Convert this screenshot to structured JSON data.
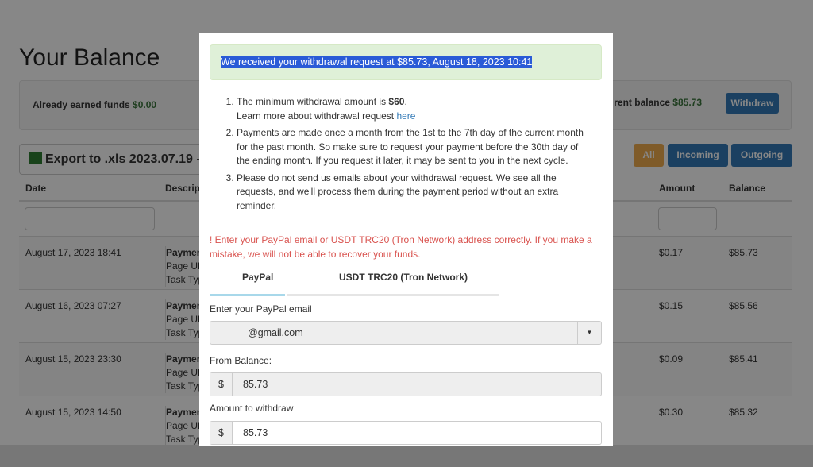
{
  "page": {
    "title": "Your Balance",
    "earned_label": "Already earned funds",
    "earned_value": "$0.00",
    "current_label": "rent balance",
    "current_value": "$85.73",
    "withdraw": "Withdraw",
    "export": "Export to .xls 2023.07.19 -",
    "filters": [
      "All",
      "Incoming",
      "Outgoing"
    ],
    "columns": {
      "date": "Date",
      "description": "Descrip",
      "amount": "Amount",
      "balance": "Balance"
    },
    "rows": [
      {
        "date": "August 17, 2023 18:41",
        "d1": "Payment",
        "d2": "Page URL",
        "d3": "Task Type",
        "amount": "$0.17",
        "balance": "$85.73"
      },
      {
        "date": "August 16, 2023 07:27",
        "d1": "Payment",
        "d2": "Page URL",
        "d3": "Task Type",
        "amount": "$0.15",
        "balance": "$85.56"
      },
      {
        "date": "August 15, 2023 23:30",
        "d1": "Payment",
        "d2": "Page URL",
        "d3": "Task Type",
        "amount": "$0.09",
        "balance": "$85.41"
      },
      {
        "date": "August 15, 2023 14:50",
        "d1": "Payment",
        "d2": "Page URL",
        "d3": "Task Type",
        "amount": "$0.30",
        "balance": "$85.32"
      }
    ]
  },
  "modal": {
    "alert": "We received your withdrawal request at $85.73, August 18, 2023 10:41",
    "rule1a": "The minimum withdrawal amount is ",
    "rule1b": "$60",
    "rule1c": ".",
    "rule1d": "Learn more about withdrawal request ",
    "rule1link": "here",
    "rule2": "Payments are made once a month from the 1st to the 7th day of the current month for the past month. So make sure to request your payment before the 30th day of the ending month. If you request it later, it may be sent to you in the next cycle.",
    "rule3": "Please do not send us emails about your withdrawal request. We see all the requests, and we'll process them during the payment period without an extra reminder.",
    "warning": "! Enter your PayPal email or USDT TRC20 (Tron Network) address correctly. If you make a mistake, we will not be able to recover your funds.",
    "tabs": [
      "PayPal",
      "USDT TRC20 (Tron Network)"
    ],
    "email_label": "Enter your PayPal email",
    "email_value": "@gmail.com",
    "from_label": "From Balance:",
    "currency": "$",
    "from_value": "85.73",
    "amount_label": "Amount to withdraw",
    "amount_value": "85.73"
  },
  "colors": {
    "primary": "#337ab7",
    "warning": "#f0ad4e",
    "success_bg": "#dff0d8",
    "danger": "#d9534f"
  }
}
